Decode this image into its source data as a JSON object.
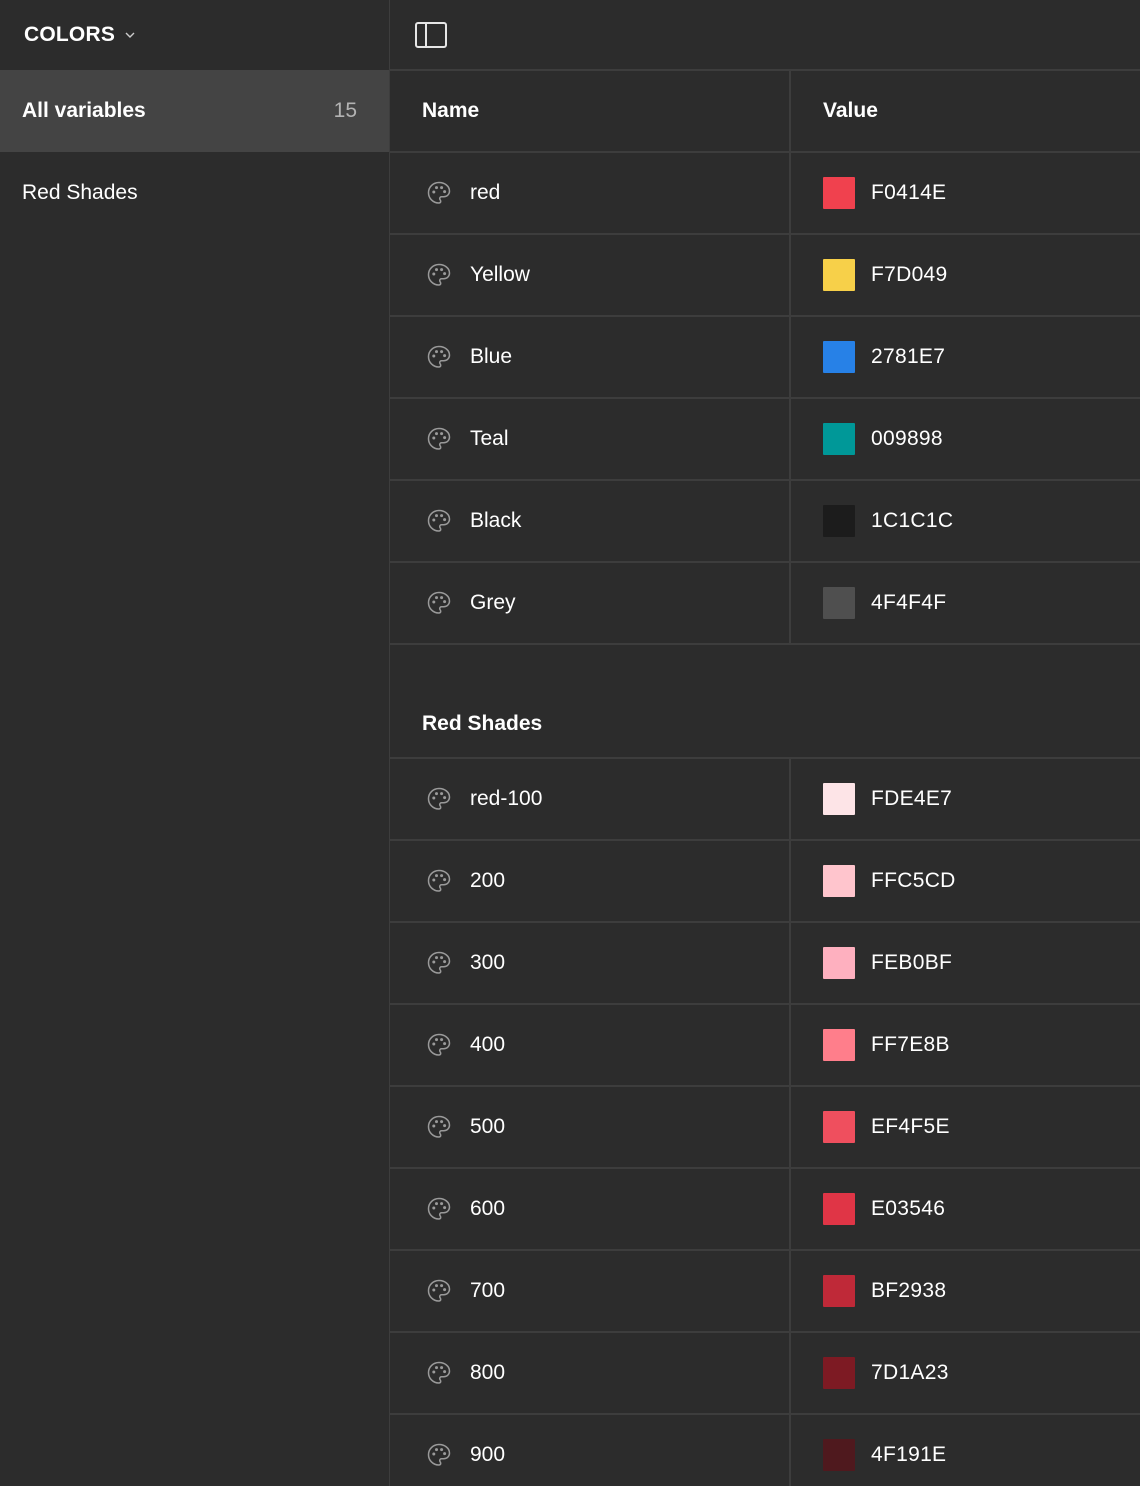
{
  "sidebar": {
    "collection_name": "COLORS",
    "items": [
      {
        "label": "All variables",
        "count": "15",
        "active": true
      },
      {
        "label": "Red Shades",
        "count": "",
        "active": false
      }
    ]
  },
  "table": {
    "headers": {
      "name": "Name",
      "value": "Value"
    },
    "ungrouped": [
      {
        "name": "red",
        "hex": "F0414E",
        "color": "#F0414E"
      },
      {
        "name": "Yellow",
        "hex": "F7D049",
        "color": "#F7D049"
      },
      {
        "name": "Blue",
        "hex": "2781E7",
        "color": "#2781E7"
      },
      {
        "name": "Teal",
        "hex": "009898",
        "color": "#009898"
      },
      {
        "name": "Black",
        "hex": "1C1C1C",
        "color": "#1C1C1C"
      },
      {
        "name": "Grey",
        "hex": "4F4F4F",
        "color": "#4F4F4F"
      }
    ],
    "groups": [
      {
        "title": "Red Shades",
        "rows": [
          {
            "name": "red-100",
            "hex": "FDE4E7",
            "color": "#FDE4E7"
          },
          {
            "name": "200",
            "hex": "FFC5CD",
            "color": "#FFC5CD"
          },
          {
            "name": "300",
            "hex": "FEB0BF",
            "color": "#FEB0BF"
          },
          {
            "name": "400",
            "hex": "FF7E8B",
            "color": "#FF7E8B"
          },
          {
            "name": "500",
            "hex": "EF4F5E",
            "color": "#EF4F5E"
          },
          {
            "name": "600",
            "hex": "E03546",
            "color": "#E03546"
          },
          {
            "name": "700",
            "hex": "BF2938",
            "color": "#BF2938"
          },
          {
            "name": "800",
            "hex": "7D1A23",
            "color": "#7D1A23"
          },
          {
            "name": "900",
            "hex": "4F191E",
            "color": "#4F191E"
          }
        ]
      }
    ]
  },
  "icons": {
    "collection_toggle": "chevron-down-icon",
    "sidebar_toggle": "sidebar-panel-icon",
    "variable_type": "palette-icon"
  },
  "theme": {
    "background": "#2c2c2c",
    "sidebar_active": "#444444",
    "divider": "#3d3d3d"
  }
}
